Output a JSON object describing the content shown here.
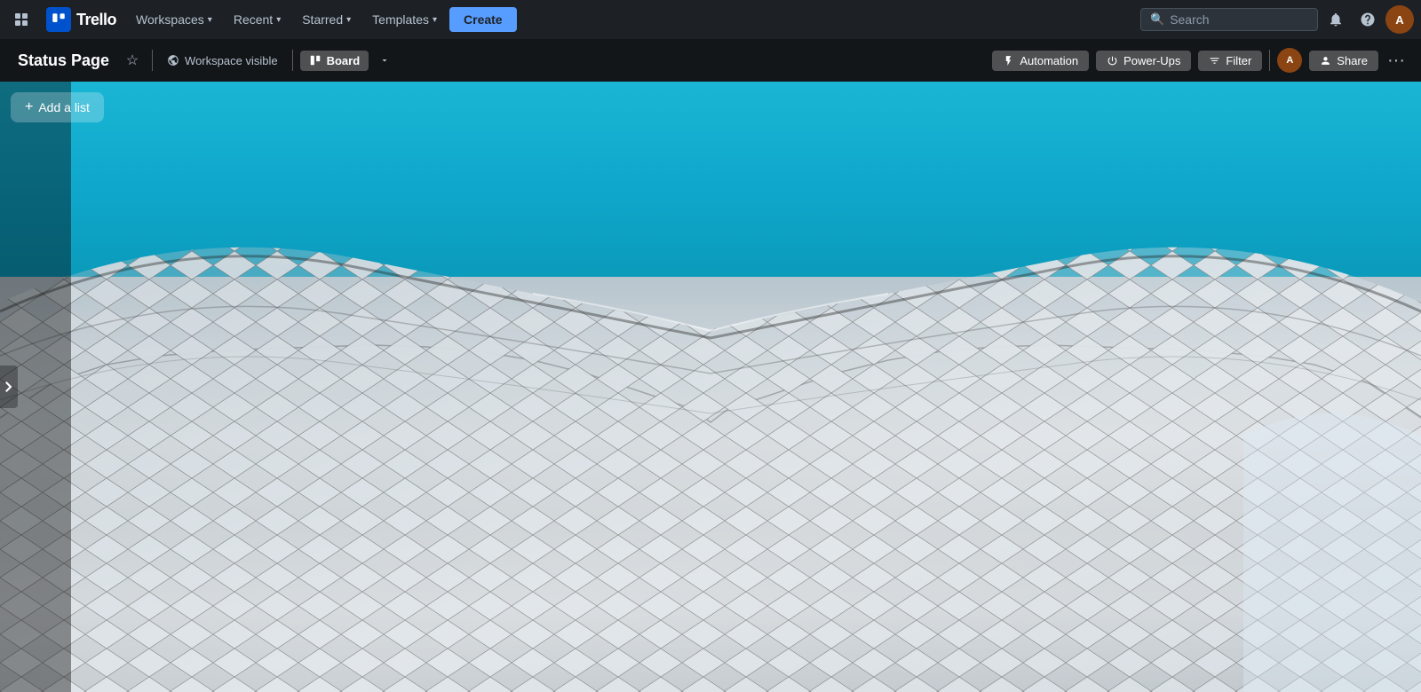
{
  "app": {
    "name": "Trello"
  },
  "topnav": {
    "logo_text": "Trello",
    "workspaces_label": "Workspaces",
    "recent_label": "Recent",
    "starred_label": "Starred",
    "templates_label": "Templates",
    "create_label": "Create",
    "search_placeholder": "Search",
    "notification_icon": "bell-icon",
    "help_icon": "help-icon",
    "avatar_initials": "A"
  },
  "board_toolbar": {
    "title": "Status Page",
    "star_icon": "star-icon",
    "workspace_visibility": "Workspace visible",
    "view_label": "Board",
    "view_icon": "board-icon",
    "view_menu_icon": "chevron-down-icon",
    "automation_label": "Automation",
    "automation_icon": "lightning-icon",
    "powerups_label": "Power-Ups",
    "powerups_icon": "power-icon",
    "filter_label": "Filter",
    "filter_icon": "filter-icon",
    "share_label": "Share",
    "share_icon": "person-icon",
    "more_icon": "ellipsis-icon"
  },
  "board_content": {
    "add_list_label": "+ Add a list",
    "background_type": "architectural mesh"
  },
  "colors": {
    "nav_bg": "#1d2125",
    "board_toolbar_bg": "rgba(0,0,0,0.32)",
    "sky_blue": "#0ea5c9",
    "mesh_color": "#e2e8f0",
    "accent_blue": "#579dff"
  }
}
